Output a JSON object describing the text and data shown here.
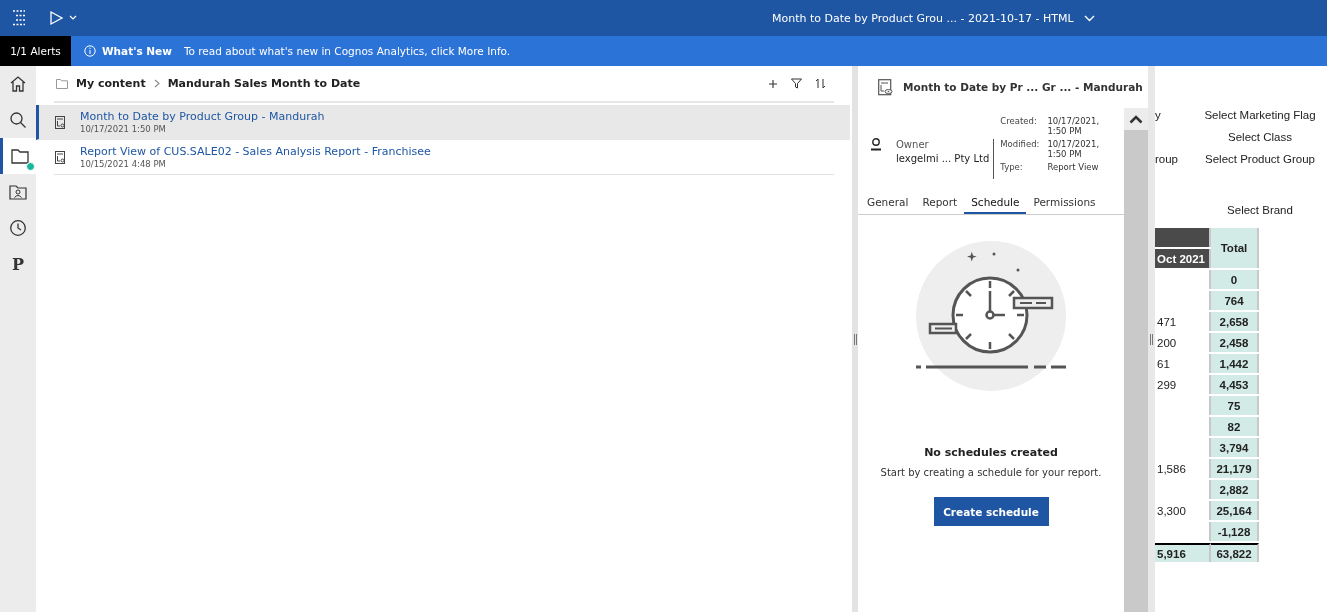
{
  "top_bar": {
    "title": "Month to Date by Product Grou ... - 2021-10-17 - HTML"
  },
  "alert_bar": {
    "count": "1/1 Alerts",
    "heading": "What's New",
    "message": "To read about what's new in Cognos Analytics, click More Info."
  },
  "rail": {
    "items": [
      {
        "kind": "home",
        "selected": false,
        "badge": false
      },
      {
        "kind": "search",
        "selected": false,
        "badge": false
      },
      {
        "kind": "folder",
        "selected": true,
        "badge": true
      },
      {
        "kind": "team",
        "selected": false,
        "badge": false
      },
      {
        "kind": "recent",
        "selected": false,
        "badge": false
      },
      {
        "kind": "glyph",
        "glyph": "P",
        "selected": false,
        "badge": false
      }
    ]
  },
  "content": {
    "breadcrumb": [
      "My content",
      "Mandurah Sales Month to Date"
    ],
    "items": [
      {
        "title": "Month to Date by Product Group - Mandurah",
        "date": "10/17/2021 1:50 PM",
        "selected": true
      },
      {
        "title": "Report View of CUS.SALE02 - Sales Analysis Report - Franchisee",
        "date": "10/15/2021 4:48 PM",
        "selected": false
      }
    ]
  },
  "details": {
    "title": "Month to Date by Pr ... Gr ... - Mandurah",
    "owner_label": "Owner",
    "owner": "lexgelmi ... Pty Ltd",
    "meta": [
      {
        "label": "Created:",
        "value": "10/17/2021, 1:50 PM"
      },
      {
        "label": "Modified:",
        "value": "10/17/2021, 1:50 PM"
      },
      {
        "label": "Type:",
        "value": "Report View"
      }
    ],
    "tabs": [
      {
        "label": "General",
        "selected": false
      },
      {
        "label": "Report",
        "selected": false
      },
      {
        "label": "Schedule",
        "selected": true
      },
      {
        "label": "Permissions",
        "selected": false
      }
    ],
    "empty_title": "No schedules created",
    "empty_text": "Start by creating a schedule for your report.",
    "button": "Create schedule"
  },
  "report": {
    "filters": [
      {
        "left": "y",
        "right": "Select Marketing Flag"
      },
      {
        "right": "Select Class"
      },
      {
        "left": "roup",
        "right": "Select Product Group"
      },
      {
        "right": "Select Brand"
      }
    ],
    "header": {
      "column_1": "Oct 2021",
      "total": "Total"
    },
    "rows": [
      {
        "column_1": "",
        "total": "0",
        "kind": "row"
      },
      {
        "column_1": "",
        "total": "764",
        "kind": "row"
      },
      {
        "column_1": "471",
        "total": "2,658",
        "kind": "row"
      },
      {
        "column_1": "200",
        "total": "2,458",
        "kind": "row"
      },
      {
        "column_1": "61",
        "total": "1,442",
        "kind": "row"
      },
      {
        "column_1": "299",
        "total": "4,453",
        "kind": "row"
      },
      {
        "column_1": "",
        "total": "75",
        "kind": "row"
      },
      {
        "column_1": "",
        "total": "82",
        "kind": "row"
      },
      {
        "column_1": "",
        "total": "3,794",
        "kind": "row"
      },
      {
        "column_1": "1,586",
        "total": "21,179",
        "kind": "row"
      },
      {
        "column_1": "",
        "total": "2,882",
        "kind": "row"
      },
      {
        "column_1": "3,300",
        "total": "25,164",
        "kind": "row"
      },
      {
        "column_1": "",
        "total": "-1,128",
        "kind": "row"
      },
      {
        "column_1": "5,916",
        "total": "63,822",
        "kind": "total"
      }
    ]
  }
}
